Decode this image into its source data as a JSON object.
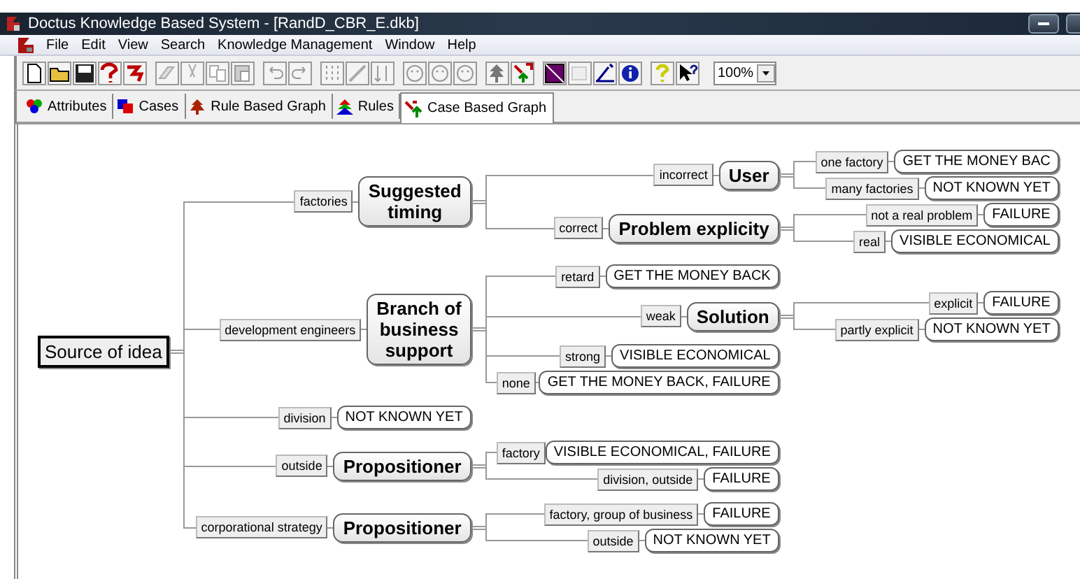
{
  "window": {
    "title": "Doctus Knowledge Based System - [RandD_CBR_E.dkb]"
  },
  "menu": [
    "File",
    "Edit",
    "View",
    "Search",
    "Knowledge Management",
    "Window",
    "Help"
  ],
  "toolbar": {
    "zoom": "100%"
  },
  "tabs": [
    {
      "label": "Attributes",
      "selected": false
    },
    {
      "label": "Cases",
      "selected": false
    },
    {
      "label": "Rule Based Graph",
      "selected": false
    },
    {
      "label": "Rules",
      "selected": false
    },
    {
      "label": "Case Based Graph",
      "selected": true
    }
  ],
  "graph": {
    "root": {
      "label": "Source of idea",
      "kind": "root",
      "children": [
        {
          "edge": "factories",
          "node": {
            "label": "Suggested\ntiming",
            "kind": "attribute",
            "children": [
              {
                "edge": "incorrect",
                "node": {
                  "label": "User",
                  "kind": "attribute",
                  "children": [
                    {
                      "edge": "one factory",
                      "node": {
                        "label": "GET THE MONEY BAC",
                        "kind": "outcome"
                      }
                    },
                    {
                      "edge": "many factories",
                      "node": {
                        "label": "NOT KNOWN YET",
                        "kind": "outcome"
                      }
                    }
                  ]
                }
              },
              {
                "edge": "correct",
                "node": {
                  "label": "Problem explicity",
                  "kind": "attribute",
                  "children": [
                    {
                      "edge": "not a real problem",
                      "node": {
                        "label": "FAILURE",
                        "kind": "outcome"
                      }
                    },
                    {
                      "edge": "real",
                      "node": {
                        "label": "VISIBLE ECONOMICAL",
                        "kind": "outcome"
                      }
                    }
                  ]
                }
              }
            ]
          }
        },
        {
          "edge": "development engineers",
          "node": {
            "label": "Branch of\nbusiness\nsupport",
            "kind": "attribute",
            "children": [
              {
                "edge": "retard",
                "node": {
                  "label": "GET THE MONEY BACK",
                  "kind": "outcome"
                }
              },
              {
                "edge": "weak",
                "node": {
                  "label": "Solution",
                  "kind": "attribute",
                  "children": [
                    {
                      "edge": "explicit",
                      "node": {
                        "label": "FAILURE",
                        "kind": "outcome"
                      }
                    },
                    {
                      "edge": "partly explicit",
                      "node": {
                        "label": "NOT KNOWN YET",
                        "kind": "outcome"
                      }
                    }
                  ]
                }
              },
              {
                "edge": "strong",
                "node": {
                  "label": "VISIBLE ECONOMICAL",
                  "kind": "outcome"
                }
              },
              {
                "edge": "none",
                "node": {
                  "label": "GET THE MONEY BACK, FAILURE",
                  "kind": "outcome"
                }
              }
            ]
          }
        },
        {
          "edge": "division",
          "node": {
            "label": "NOT KNOWN YET",
            "kind": "outcome"
          }
        },
        {
          "edge": "outside",
          "node": {
            "label": "Propositioner",
            "kind": "attribute",
            "children": [
              {
                "edge": "factory",
                "node": {
                  "label": "VISIBLE ECONOMICAL, FAILURE",
                  "kind": "outcome"
                }
              },
              {
                "edge": "division, outside",
                "node": {
                  "label": "FAILURE",
                  "kind": "outcome"
                }
              }
            ]
          }
        },
        {
          "edge": "corporational strategy",
          "node": {
            "label": "Propositioner",
            "kind": "attribute",
            "children": [
              {
                "edge": "factory, group of business",
                "node": {
                  "label": "FAILURE",
                  "kind": "outcome"
                }
              },
              {
                "edge": "outside",
                "node": {
                  "label": "NOT KNOWN YET",
                  "kind": "outcome"
                }
              }
            ]
          }
        }
      ]
    }
  }
}
